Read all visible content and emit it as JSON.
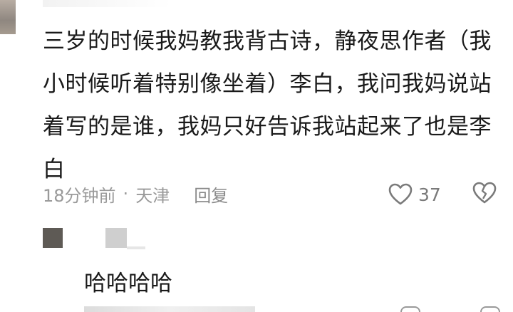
{
  "comment": {
    "text": "三岁的时候我妈教我背古诗，静夜思作者（我小时候听着特别像坐着）李白，我问我妈说站着写的是谁，我妈只好告诉我站起来了也是李白",
    "time": "18分钟前",
    "separator": "·",
    "location": "天津",
    "reply_label": "回复",
    "like_count": "37",
    "icons": {
      "like": "heart-icon",
      "dislike": "broken-heart-icon"
    }
  },
  "reply": {
    "text": "哈哈哈哈"
  },
  "colors": {
    "text": "#1a1a1a",
    "meta": "#9a9a9a",
    "background": "#ffffff"
  }
}
